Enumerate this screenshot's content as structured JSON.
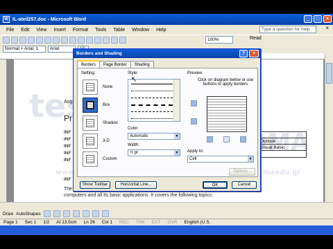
{
  "window": {
    "title": "IL-ateil257.doc - Microsoft Word"
  },
  "menu": {
    "items": [
      "File",
      "Edit",
      "View",
      "Insert",
      "Format",
      "Tools",
      "Table",
      "Window",
      "Help"
    ],
    "help_placeholder": "Type a question for help"
  },
  "toolbar": {
    "zoom": "100%",
    "read_label": "Read",
    "style_value": "Normal + Arial, 1",
    "font_value": "Arial",
    "size_value": "10"
  },
  "document": {
    "text_ang": "Ang",
    "text_pr": "Pr",
    "inf_rows": [
      "INF",
      "INF",
      "INF",
      "INF",
      "INF"
    ],
    "inf_heading": "INF",
    "the_text": "The",
    "body_line": "computers and all its basic applications. It covers the following topics:",
    "table_cells": [
      "",
      "Outlook",
      "Visual Basic",
      ""
    ],
    "watermark_1": "test",
    "watermark_2": "DIPLOMA",
    "watermark_url_1": "www.test4u.eu",
    "watermark_url_2": "www.diplomaedu.gr"
  },
  "dialog": {
    "title": "Borders and Shading",
    "tabs": [
      "Borders",
      "Page Border",
      "Shading"
    ],
    "setting_label": "Setting:",
    "settings": [
      "None",
      "Box",
      "Shadow",
      "3-D",
      "Custom"
    ],
    "style_label": "Style:",
    "color_label": "Color:",
    "color_value": "Automatic",
    "width_label": "Width:",
    "width_value": "½ pt",
    "preview_label": "Preview",
    "preview_hint": "Click on diagram below or use buttons to apply borders",
    "apply_label": "Apply to:",
    "apply_value": "Cell",
    "options_label": "Options...",
    "show_toolbar": "Show Toolbar",
    "horizontal_line": "Horizontal Line...",
    "ok": "OK",
    "cancel": "Cancel"
  },
  "drawbar": {
    "draw": "Draw",
    "autoshapes": "AutoShapes"
  },
  "status": {
    "page": "Page 1",
    "sec": "Sec 1",
    "pages": "1/2",
    "at": "At 13,5cm",
    "ln": "Ln 26",
    "col": "Col 1",
    "rec": "REC",
    "trk": "TRK",
    "ext": "EXT",
    "ovr": "OVR",
    "lang": "English (U.S."
  }
}
